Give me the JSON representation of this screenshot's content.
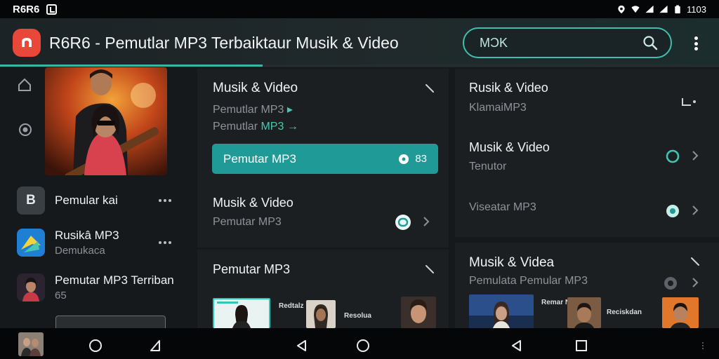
{
  "status_bar": {
    "carrier": "R6R6",
    "time": "1103"
  },
  "app_bar": {
    "title": "R6R6 - Pemutlar MP3 Terbaiktaur Musik & Video",
    "search_value": "MƆK",
    "progress_fraction": 0.365
  },
  "left_list": [
    {
      "title": "Pemular kai",
      "subtitle": "",
      "thumb_letter": "B"
    },
    {
      "title": "Rusikâ MP3",
      "subtitle": "Demukaca"
    },
    {
      "title": "Pemutar MP3 Terriban",
      "subtitle": "65"
    }
  ],
  "panel_mid_1": {
    "title": "Musik & Video",
    "line1": "Pemutlar MP3",
    "line2_prefix": "Pemutlar ",
    "line2_accent": "MP3",
    "button_label": "Pemutar MP3",
    "button_count": "83"
  },
  "panel_mid_2": {
    "title": "Musik & Video",
    "subtitle": "Pemutar MP3"
  },
  "panel_mid_3": {
    "title": "Pemutar MP3",
    "thumb_labels": [
      "Redtalz",
      "Resolua"
    ]
  },
  "panel_right_1": {
    "item1_title": "Rusik & Video",
    "item1_sub": "KlamaiMP3",
    "item2_title": "Musik & Video",
    "item2_sub": "Tenutor",
    "item3_title": "Viseatar MP3"
  },
  "panel_right_2": {
    "title": "Musik & Videa",
    "subtitle": "Pemulata Pemular MP3",
    "thumb_labels": [
      "Remar NItS",
      "Reciskdan"
    ]
  },
  "colors": {
    "accent": "#36b7a6",
    "logo": "#e8473a",
    "button": "#1f9a97"
  }
}
